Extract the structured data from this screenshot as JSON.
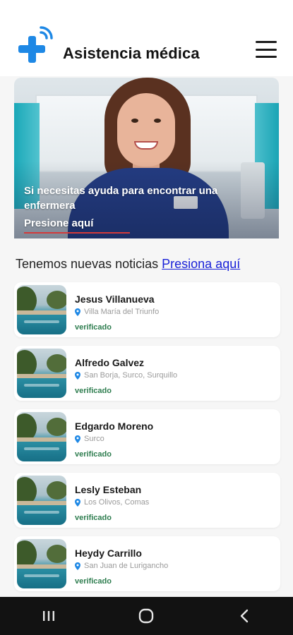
{
  "header": {
    "title": "Asistencia médica"
  },
  "hero": {
    "text": "Si necesitas ayuda para encontrar una enfermera",
    "link": "Presione aquí"
  },
  "news": {
    "text": "Tenemos nuevas noticias",
    "link": "Presiona aquí"
  },
  "nurses": [
    {
      "name": "Jesus Villanueva",
      "location": "Villa María del Triunfo",
      "status": "verificado"
    },
    {
      "name": "Alfredo Galvez",
      "location": "San Borja, Surco, Surquillo",
      "status": "verificado"
    },
    {
      "name": "Edgardo Moreno",
      "location": "Surco",
      "status": "verificado"
    },
    {
      "name": "Lesly Esteban",
      "location": "Los Olivos, Comas",
      "status": "verificado"
    },
    {
      "name": "Heydy Carrillo",
      "location": "San Juan de Lurigancho",
      "status": "verificado"
    }
  ],
  "colors": {
    "brand": "#1e88e5",
    "link": "#1a22d8",
    "verified": "#2e7d4f",
    "navbar": "#121212"
  },
  "icons": {
    "logo": "medical-plus-signal-icon",
    "menu": "hamburger-menu-icon",
    "location": "location-pin-icon",
    "nav_recents": "recents-icon",
    "nav_home": "home-icon",
    "nav_back": "back-icon"
  }
}
